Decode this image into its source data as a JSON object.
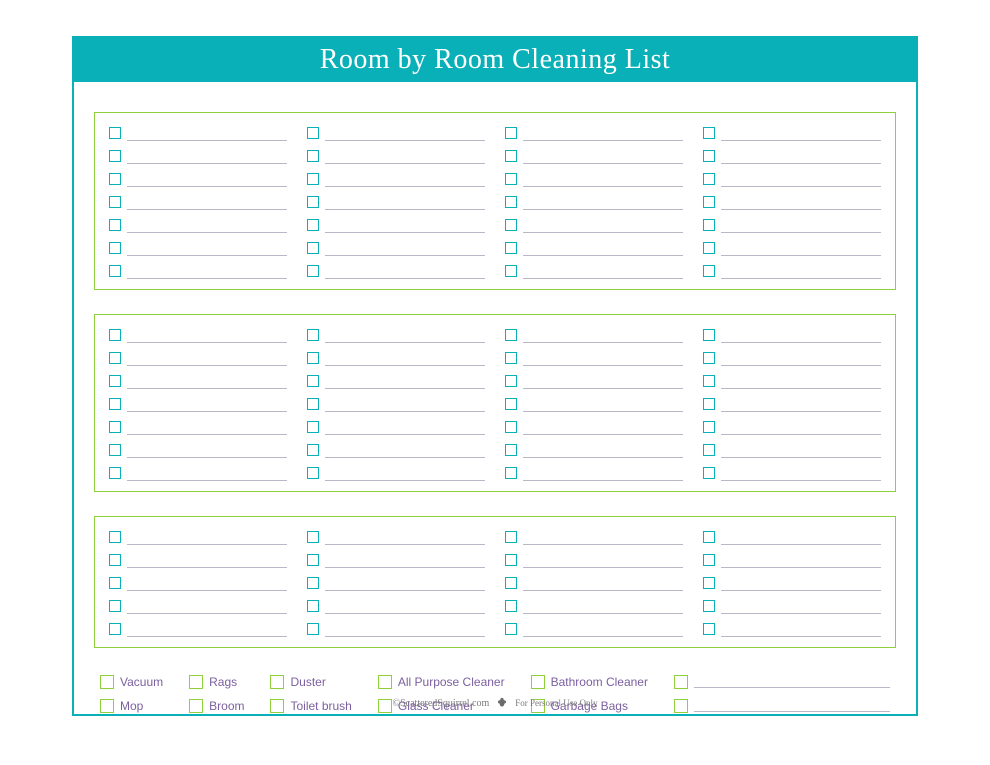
{
  "header": {
    "title": "Room by Room Cleaning List"
  },
  "sections": {
    "count": 3,
    "columns_per_section": 4,
    "rows_per_column_section1": 7,
    "rows_per_column_section2": 7,
    "rows_per_column_section3": 5
  },
  "supplies": {
    "col1": [
      "Vacuum",
      "Mop"
    ],
    "col2": [
      "Rags",
      "Broom"
    ],
    "col3": [
      "Duster",
      "Toilet brush"
    ],
    "col4": [
      "All Purpose Cleaner",
      "Glass Cleaner"
    ],
    "col5": [
      "Bathroom Cleaner",
      "Garbage Bags"
    ]
  },
  "footer": {
    "copyright": "©ScatteredSquirrel.com",
    "note": "For Personal Use Only"
  }
}
